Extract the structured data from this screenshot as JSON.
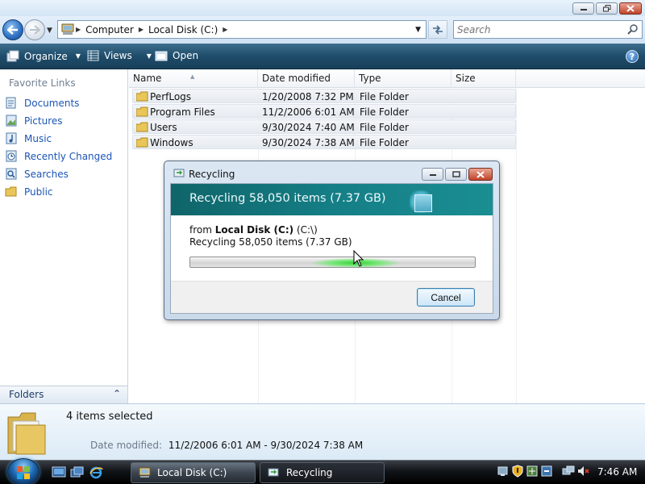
{
  "address": {
    "segments": [
      "Computer",
      "Local Disk (C:)"
    ],
    "search_placeholder": "Search"
  },
  "toolbar": {
    "organize_label": "Organize",
    "views_label": "Views",
    "open_label": "Open"
  },
  "nav": {
    "favorites_header": "Favorite Links",
    "links": [
      {
        "label": "Documents",
        "icon": "documents-icon"
      },
      {
        "label": "Pictures",
        "icon": "pictures-icon"
      },
      {
        "label": "Music",
        "icon": "music-icon"
      },
      {
        "label": "Recently Changed",
        "icon": "recently-changed-icon"
      },
      {
        "label": "Searches",
        "icon": "searches-icon"
      },
      {
        "label": "Public",
        "icon": "public-folder-icon"
      }
    ],
    "folders_label": "Folders"
  },
  "filelist": {
    "columns": [
      "Name",
      "Date modified",
      "Type",
      "Size"
    ],
    "rows": [
      {
        "name": "PerfLogs",
        "date": "1/20/2008 7:32 PM",
        "type": "File Folder",
        "size": ""
      },
      {
        "name": "Program Files",
        "date": "11/2/2006 6:01 AM",
        "type": "File Folder",
        "size": ""
      },
      {
        "name": "Users",
        "date": "9/30/2024 7:40 AM",
        "type": "File Folder",
        "size": ""
      },
      {
        "name": "Windows",
        "date": "9/30/2024 7:38 AM",
        "type": "File Folder",
        "size": ""
      }
    ]
  },
  "dialog": {
    "title": "Recycling",
    "banner": "Recycling 58,050 items (7.37 GB)",
    "from_prefix": "from",
    "from_bold": "Local Disk (C:)",
    "from_path": "(C:\\)",
    "status": "Recycling 58,050 items (7.37 GB)",
    "progress_fraction": 0.58,
    "cancel_label": "Cancel"
  },
  "details": {
    "selected_count": "4 items selected",
    "modified_label": "Date modified:",
    "modified_value": "11/2/2006 6:01 AM - 9/30/2024 7:38 AM"
  },
  "taskbar": {
    "tasks": [
      "Local Disk (C:)",
      "Recycling"
    ],
    "clock": "7:46 AM"
  },
  "colors": {
    "toolbar": "#1f4d6b",
    "link": "#1c55b5",
    "banner": "#157e86",
    "progress": "#36d03a"
  }
}
